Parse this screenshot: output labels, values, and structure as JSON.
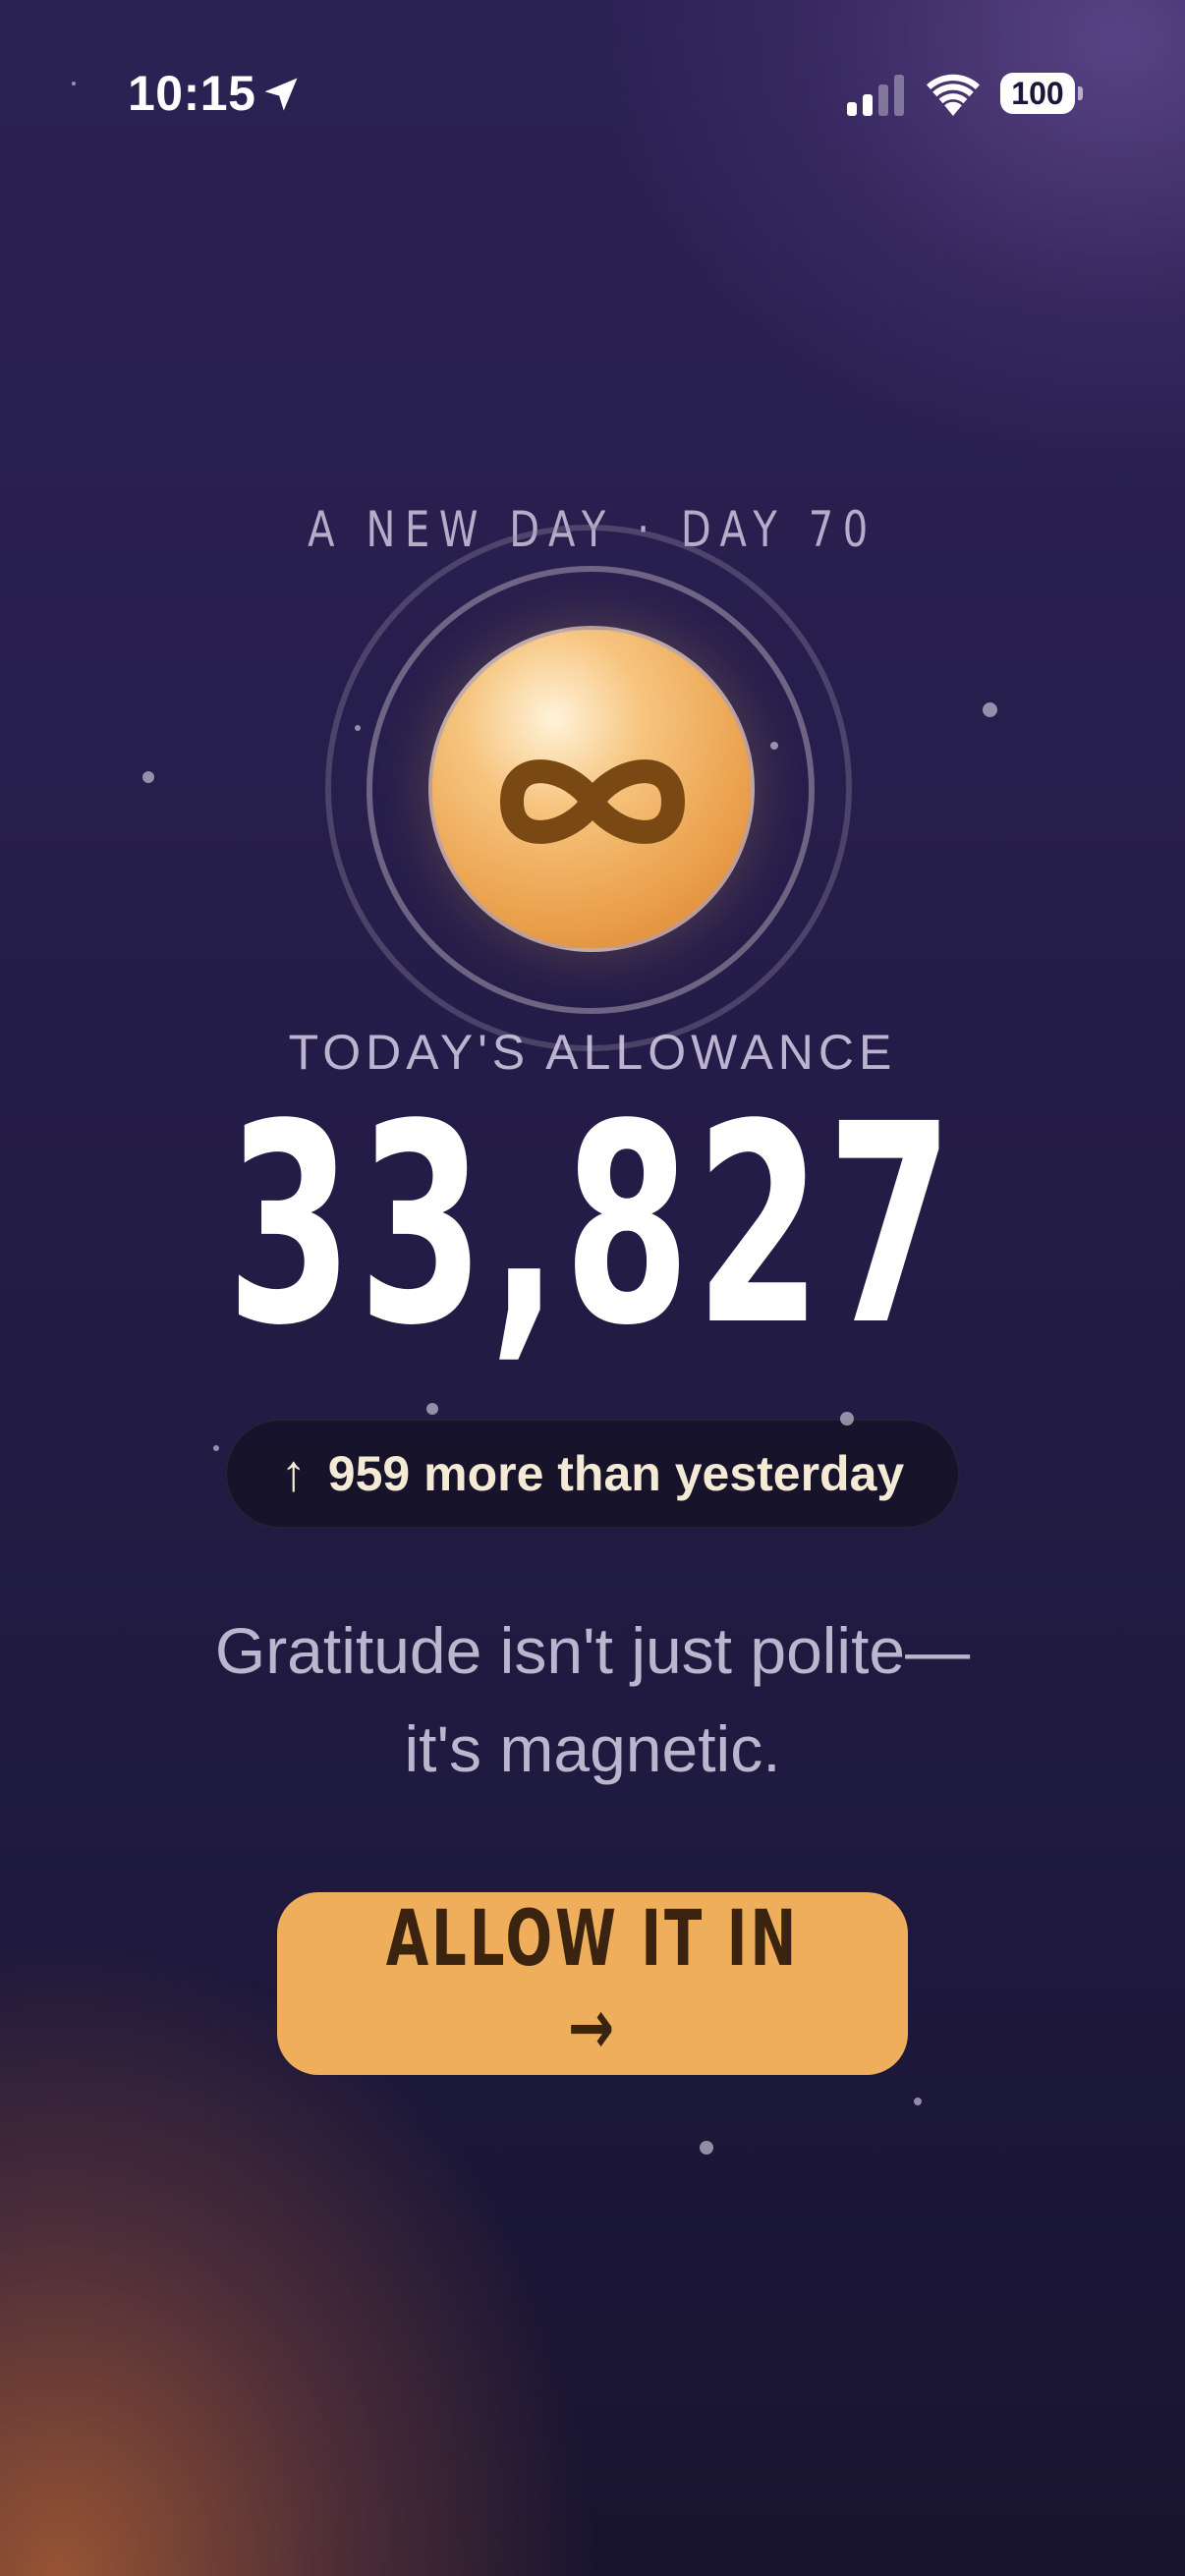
{
  "status_bar": {
    "time": "10:15",
    "battery": "100",
    "icons": [
      "location-arrow-icon",
      "cellular-signal-icon",
      "wifi-icon",
      "battery-icon"
    ]
  },
  "header": {
    "day_label": "A NEW DAY · DAY 70"
  },
  "orb": {
    "icon": "infinity-icon",
    "colors": {
      "orb": "#eca552",
      "symbol": "#7a4812"
    }
  },
  "allowance": {
    "label": "TODAY'S ALLOWANCE",
    "value": "33,827"
  },
  "change": {
    "arrow": "↑",
    "text": "959 more than yesterday"
  },
  "quote": {
    "line1": "Gratitude isn't just polite—",
    "line2": "it's magnetic."
  },
  "cta": {
    "label": "ALLOW IT IN →",
    "color": "#eeae5b"
  }
}
